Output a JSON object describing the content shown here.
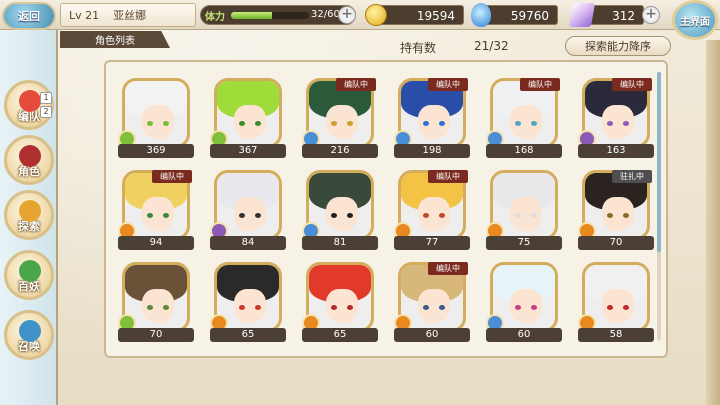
{
  "header": {
    "back_label": "返回",
    "level": "Lv 21",
    "player_name": "亚丝娜",
    "stamina_label": "体力",
    "stamina_text": "32/60",
    "stamina_fraction": 0.53,
    "coins": "19594",
    "gems": "59760",
    "crystals": "312",
    "home_label": "主界面"
  },
  "list": {
    "tab_label": "角色列表",
    "owned_label": "持有数",
    "owned_count": "21/32",
    "sort_label": "探索能力降序",
    "scroll_fraction": 0.67
  },
  "nav": {
    "items": [
      {
        "label": "编队",
        "color": "#e44b3a"
      },
      {
        "label": "角色",
        "color": "#b03030"
      },
      {
        "label": "探索",
        "color": "#e6a531"
      },
      {
        "label": "百妖",
        "color": "#4aa64a"
      },
      {
        "label": "召唤",
        "color": "#3f93c7"
      }
    ],
    "badges": [
      "1",
      "2"
    ]
  },
  "characters": [
    {
      "level": "369",
      "tag": "",
      "hair": "#f2f2f2",
      "eye": "#7bbb3a",
      "element": "#7fbf3a"
    },
    {
      "level": "367",
      "tag": "",
      "hair": "#9fdc3a",
      "eye": "#3a8a2a",
      "element": "#7fbf3a"
    },
    {
      "level": "216",
      "tag": "编队中",
      "hair": "#2a5a3a",
      "eye": "#c9a030",
      "element": "#4a8fd6"
    },
    {
      "level": "198",
      "tag": "编队中",
      "hair": "#2a4ea8",
      "eye": "#2a6fd6",
      "element": "#4a8fd6"
    },
    {
      "level": "168",
      "tag": "编队中",
      "hair": "#eef0f2",
      "eye": "#4aa6c4",
      "element": "#4a8fd6"
    },
    {
      "level": "163",
      "tag": "编队中",
      "hair": "#2a2a3a",
      "eye": "#8a5ab6",
      "element": "#8a5ab6"
    },
    {
      "level": "94",
      "tag": "编队中",
      "hair": "#f0d060",
      "eye": "#3a8a3a",
      "element": "#e8891f"
    },
    {
      "level": "84",
      "tag": "",
      "hair": "#e8e8ee",
      "eye": "#333333",
      "element": "#8a5ab6"
    },
    {
      "level": "81",
      "tag": "",
      "hair": "#3a4a3a",
      "eye": "#222222",
      "element": "#4a8fd6"
    },
    {
      "level": "77",
      "tag": "编队中",
      "hair": "#f3c346",
      "eye": "#c04a2a",
      "element": "#e8891f"
    },
    {
      "level": "75",
      "tag": "",
      "hair": "#e8e8ea",
      "eye": "#dddddd",
      "element": "#e8891f"
    },
    {
      "level": "70",
      "tag": "驻扎中",
      "hair": "#2a2320",
      "eye": "#8a6a2a",
      "element": "#e8891f",
      "tag_gray": true
    },
    {
      "level": "70",
      "tag": "",
      "hair": "#6a5238",
      "eye": "#5a8a3a",
      "element": "#7fbf3a"
    },
    {
      "level": "65",
      "tag": "",
      "hair": "#2a2a2a",
      "eye": "#c93a2a",
      "element": "#e8891f"
    },
    {
      "level": "65",
      "tag": "",
      "hair": "#e23a2a",
      "eye": "#b02a2a",
      "element": "#e8891f"
    },
    {
      "level": "60",
      "tag": "编队中",
      "hair": "#d7b87a",
      "eye": "#3a5a8a",
      "element": "#e8891f"
    },
    {
      "level": "60",
      "tag": "",
      "hair": "#e6f3f8",
      "eye": "#c9408a",
      "element": "#4a8fd6"
    },
    {
      "level": "58",
      "tag": "",
      "hair": "#f0f0f0",
      "eye": "#c02a2a",
      "element": "#e8891f"
    }
  ]
}
